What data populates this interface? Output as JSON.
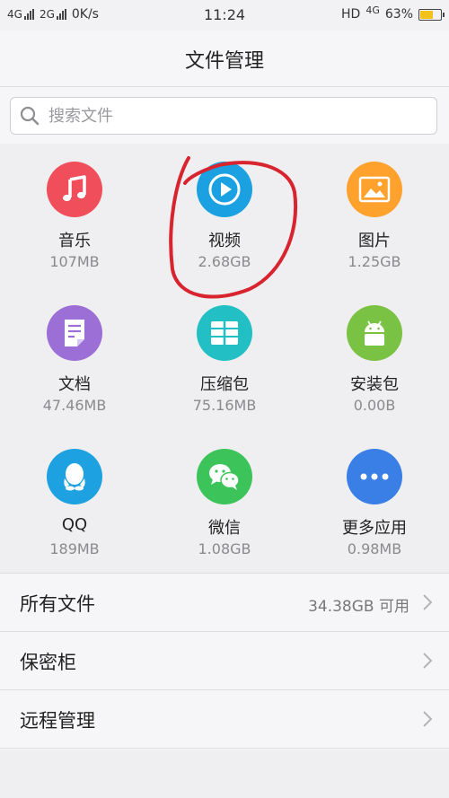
{
  "status_bar": {
    "signal1": "4G",
    "signal2": "2G",
    "speed": "0K/s",
    "time": "11:24",
    "network": "HD",
    "network_badge": "4G",
    "battery": "63%",
    "battery_level": 0.63
  },
  "header": {
    "title": "文件管理"
  },
  "search": {
    "placeholder": "搜索文件"
  },
  "categories": [
    {
      "name": "音乐",
      "size": "107MB",
      "color": "#f04e5b",
      "icon": "music-note-icon"
    },
    {
      "name": "视频",
      "size": "2.68GB",
      "color": "#1ba1e2",
      "icon": "play-icon"
    },
    {
      "name": "图片",
      "size": "1.25GB",
      "color": "#ffa12d",
      "icon": "picture-icon"
    },
    {
      "name": "文档",
      "size": "47.46MB",
      "color": "#9b6fd6",
      "icon": "document-icon"
    },
    {
      "name": "压缩包",
      "size": "75.16MB",
      "color": "#22bfc4",
      "icon": "archive-icon"
    },
    {
      "name": "安装包",
      "size": "0.00B",
      "color": "#7ac243",
      "icon": "android-icon"
    },
    {
      "name": "QQ",
      "size": "189MB",
      "color": "#1da1e0",
      "icon": "qq-penguin-icon"
    },
    {
      "name": "微信",
      "size": "1.08GB",
      "color": "#3cc35a",
      "icon": "wechat-icon"
    },
    {
      "name": "更多应用",
      "size": "0.98MB",
      "color": "#3a7fe6",
      "icon": "more-dots-icon"
    }
  ],
  "list": [
    {
      "label": "所有文件",
      "value": "34.38GB 可用"
    },
    {
      "label": "保密柜",
      "value": ""
    },
    {
      "label": "远程管理",
      "value": ""
    }
  ]
}
